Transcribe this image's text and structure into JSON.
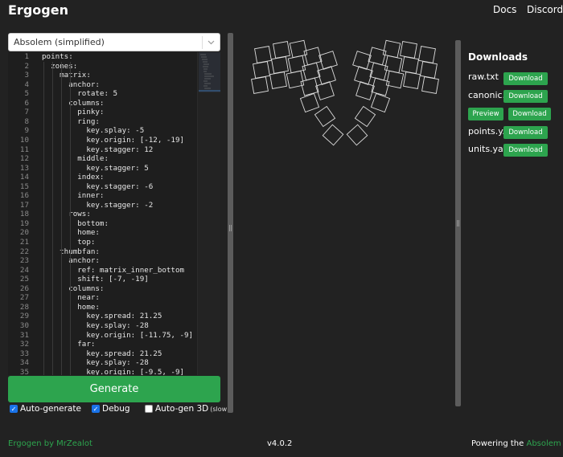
{
  "header": {
    "title": "Ergogen",
    "nav": [
      "Docs",
      "Discord"
    ]
  },
  "config_select": {
    "value": "Absolem (simplified)"
  },
  "editor": {
    "line_numbers": [
      "1",
      "2",
      "3",
      "4",
      "5",
      "6",
      "7",
      "8",
      "9",
      "10",
      "11",
      "12",
      "13",
      "14",
      "15",
      "16",
      "17",
      "18",
      "19",
      "20",
      "21",
      "22",
      "23",
      "24",
      "25",
      "26",
      "27",
      "28",
      "29",
      "30",
      "31",
      "32",
      "33",
      "34",
      "35"
    ],
    "lines": [
      "points:",
      "  zones:",
      "    matrix:",
      "      anchor:",
      "        rotate: 5",
      "      columns:",
      "        pinky:",
      "        ring:",
      "          key.splay: -5",
      "          key.origin: [-12, -19]",
      "          key.stagger: 12",
      "        middle:",
      "          key.stagger: 5",
      "        index:",
      "          key.stagger: -6",
      "        inner:",
      "          key.stagger: -2",
      "      rows:",
      "        bottom:",
      "        home:",
      "        top:",
      "    thumbfan:",
      "      anchor:",
      "        ref: matrix_inner_bottom",
      "        shift: [-7, -19]",
      "      columns:",
      "        near:",
      "        home:",
      "          key.spread: 21.25",
      "          key.splay: -28",
      "          key.origin: [-11.75, -9]",
      "        far:",
      "          key.spread: 21.25",
      "          key.splay: -28",
      "          key.origin: [-9.5, -9]"
    ]
  },
  "actions": {
    "generate_label": "Generate",
    "auto_generate_label": "Auto-generate",
    "auto_generate_checked": true,
    "debug_label": "Debug",
    "debug_checked": true,
    "auto_gen_3d_label": "Auto-gen 3D",
    "auto_gen_3d_note": "(slow)",
    "auto_gen_3d_checked": false
  },
  "downloads": {
    "title": "Downloads",
    "files": [
      {
        "name": "raw.txt",
        "buttons": [
          "Download"
        ]
      },
      {
        "name": "canonic...",
        "buttons": [
          "Download"
        ]
      },
      {
        "name": "",
        "buttons": [
          "Preview",
          "Download"
        ]
      },
      {
        "name": "points.y...",
        "buttons": [
          "Download"
        ]
      },
      {
        "name": "units.ya...",
        "buttons": [
          "Download"
        ]
      }
    ]
  },
  "footer": {
    "left": "Ergogen by MrZealot",
    "version": "v4.0.2",
    "right_prefix": "Powering the",
    "right_link": "Absolem"
  },
  "colors": {
    "accent": "#2da44e",
    "background": "#222222",
    "editor_bg": "#1e1e1e",
    "key_outline": "#dddddd"
  }
}
